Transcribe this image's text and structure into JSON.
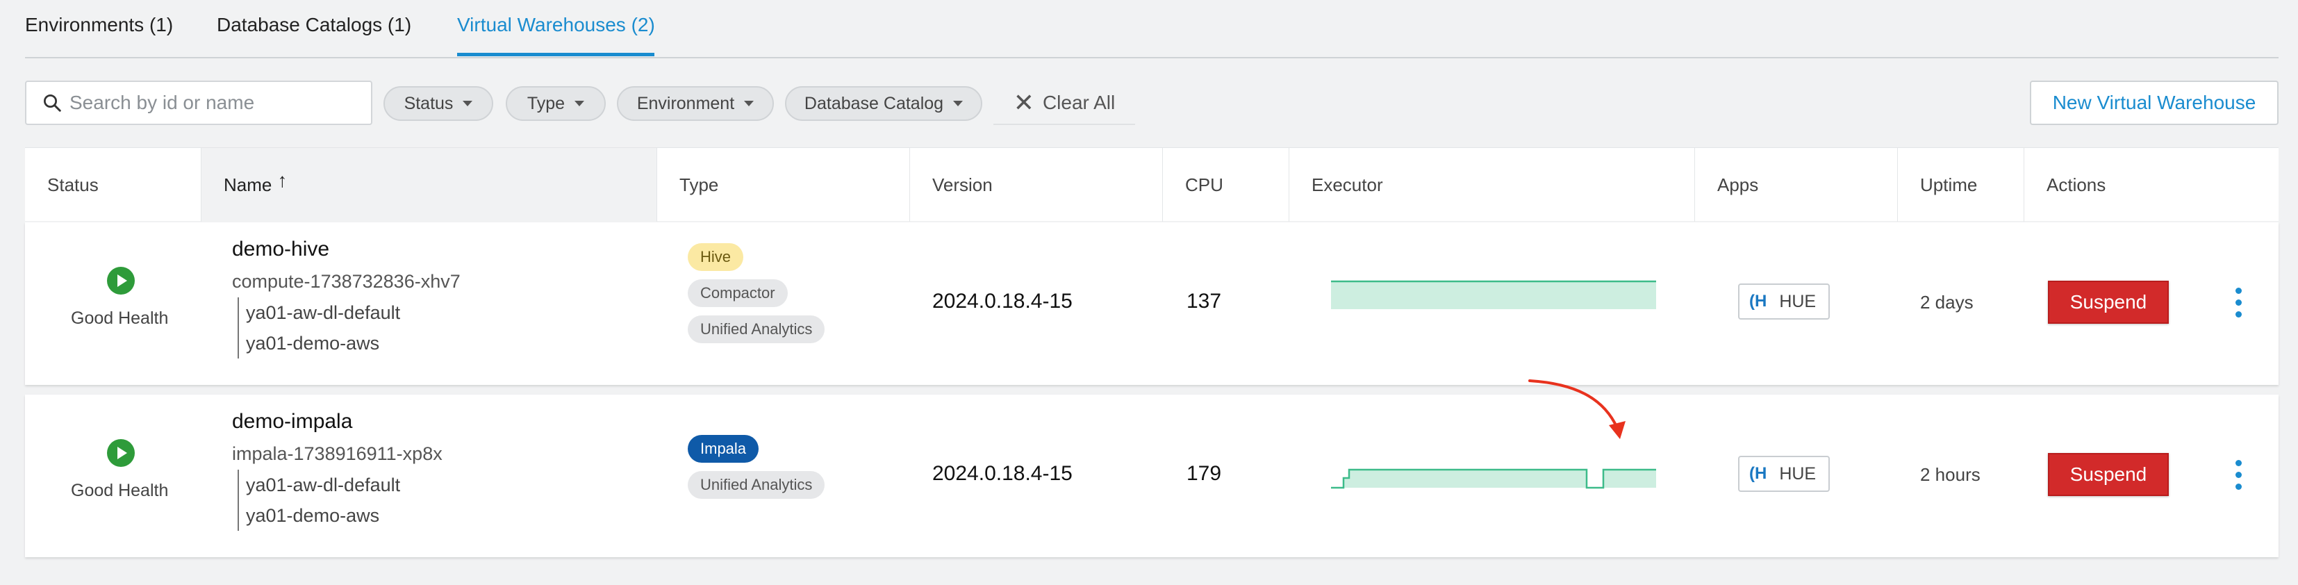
{
  "tabs": [
    {
      "label": "Environments (1)"
    },
    {
      "label": "Database Catalogs (1)"
    },
    {
      "label": "Virtual Warehouses (2)"
    }
  ],
  "toolbar": {
    "search_placeholder": "Search by id or name",
    "filters": [
      "Status",
      "Type",
      "Environment",
      "Database Catalog"
    ],
    "clear_all": "Clear All",
    "new_button": "New Virtual Warehouse"
  },
  "table": {
    "columns": [
      "Status",
      "Name",
      "Type",
      "Version",
      "CPU",
      "Executor",
      "Apps",
      "Uptime",
      "Actions"
    ],
    "sorted_column": "Name",
    "sort_direction": "ascending",
    "rows": [
      {
        "status": "Good Health",
        "name": "demo-hive",
        "id": "compute-1738732836-xhv7",
        "catalog": "ya01-aw-dl-default",
        "environment": "ya01-demo-aws",
        "types": [
          "Hive",
          "Compactor",
          "Unified Analytics"
        ],
        "version": "2024.0.18.4-15",
        "cpu": "137",
        "app": "HUE",
        "uptime": "2 days",
        "action": "Suspend"
      },
      {
        "status": "Good Health",
        "name": "demo-impala",
        "id": "impala-1738916911-xp8x",
        "catalog": "ya01-aw-dl-default",
        "environment": "ya01-demo-aws",
        "types": [
          "Impala",
          "Unified Analytics"
        ],
        "version": "2024.0.18.4-15",
        "cpu": "179",
        "app": "HUE",
        "uptime": "2 hours",
        "action": "Suspend"
      }
    ]
  },
  "colors": {
    "accent": "#1a8ccf",
    "health_ok": "#2e9b3a",
    "suspend": "#d22a2a",
    "sparkline_fill": "#cdeee0",
    "sparkline_stroke": "#3dbb8a",
    "annotation_arrow": "#e8321e",
    "hive_badge": "#fbe9a3",
    "impala_badge": "#0f5aa8"
  }
}
